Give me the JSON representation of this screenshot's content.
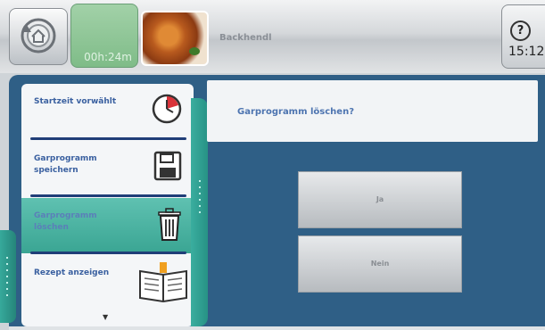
{
  "header": {
    "timer": "00h:24m",
    "program_name": "Backhendl",
    "clock": "15:12",
    "help_glyph": "?"
  },
  "menu": {
    "items": [
      {
        "label": "Startzeit vorwählt",
        "icon": "clock-icon"
      },
      {
        "label": "Garprogramm speichern",
        "icon": "save-icon"
      },
      {
        "label": "Garprogramm löschen",
        "icon": "trash-icon",
        "active": true
      },
      {
        "label": "Rezept anzeigen",
        "icon": "book-icon"
      }
    ],
    "scroll_indicator": "▼"
  },
  "dialog": {
    "question": "Garprogramm löschen?",
    "yes_label": "Ja",
    "no_label": "Nein"
  },
  "colors": {
    "accent_teal": "#3aae9f",
    "panel_blue": "#2f5f86",
    "menu_text": "#3a60a0"
  }
}
